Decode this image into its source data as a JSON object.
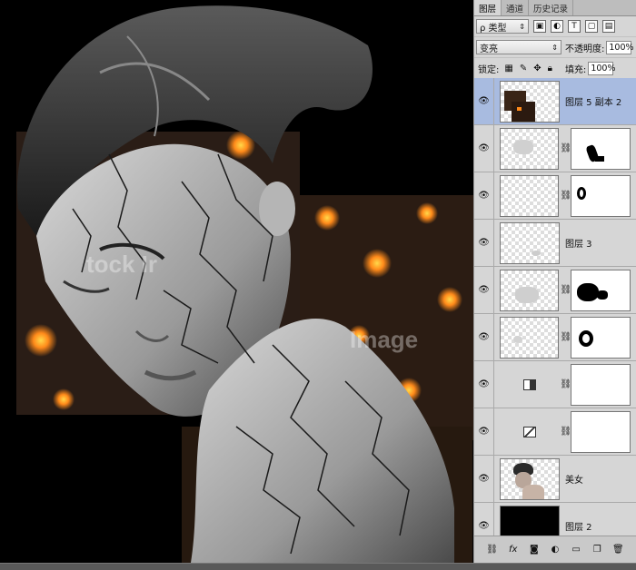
{
  "canvas": {
    "watermark_left": "tock Ir",
    "watermark_right": "Image"
  },
  "panel": {
    "tabs": [
      {
        "label": "图层",
        "active": true
      },
      {
        "label": "通道",
        "active": false
      },
      {
        "label": "历史记录",
        "active": false
      }
    ],
    "filter": {
      "label": "ρ 类型"
    },
    "blend_mode": "变亮",
    "opacity_label": "不透明度:",
    "opacity_value": "100%",
    "lock_label": "锁定:",
    "fill_label": "填充:",
    "fill_value": "100%",
    "layers": [
      {
        "name": "图层 5 副本 2",
        "selected": true
      },
      {
        "name": ""
      },
      {
        "name": ""
      },
      {
        "name": "图层 3"
      },
      {
        "name": ""
      },
      {
        "name": ""
      },
      {
        "name": ""
      },
      {
        "name": ""
      },
      {
        "name": "美女"
      },
      {
        "name": "图层 2"
      }
    ]
  },
  "colors": {
    "selected_layer": "#a8bbe0",
    "panel_bg": "#d6d6d6",
    "lava": "#ff8a1a"
  }
}
